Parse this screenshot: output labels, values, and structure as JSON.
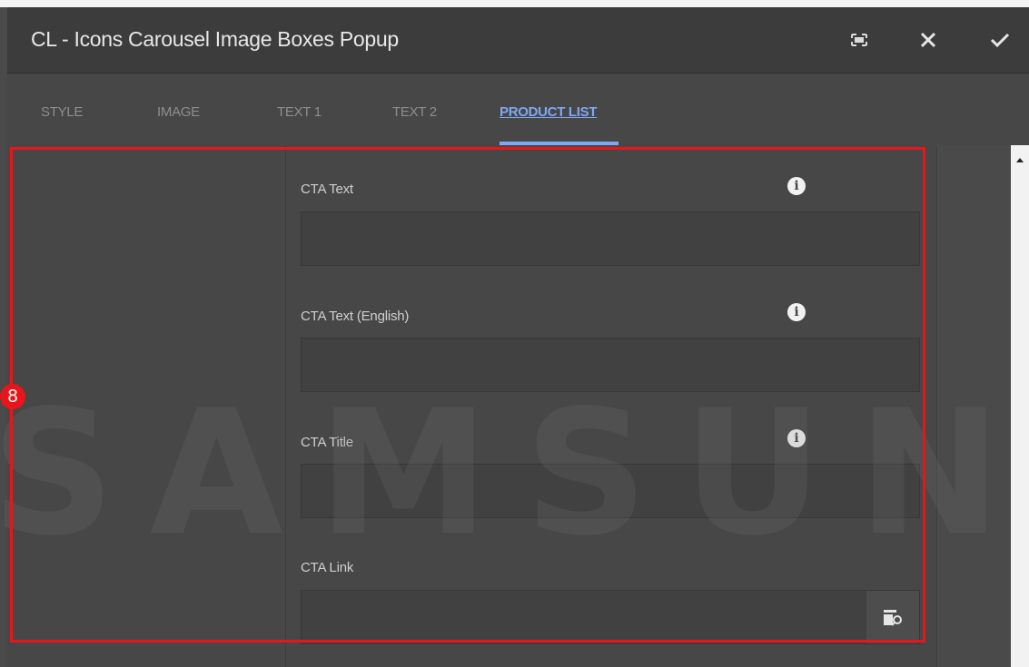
{
  "dialog": {
    "title": "CL - Icons Carousel Image Boxes Popup",
    "actions": [
      "fullscreen-icon",
      "close-icon",
      "checkmark-icon"
    ]
  },
  "tabs": [
    {
      "label": "STYLE",
      "active": false
    },
    {
      "label": "IMAGE",
      "active": false
    },
    {
      "label": "TEXT 1",
      "active": false
    },
    {
      "label": "TEXT 2",
      "active": false
    },
    {
      "label": "PRODUCT LIST",
      "active": true
    }
  ],
  "form": {
    "fields": [
      {
        "label": "CTA Text",
        "value": "",
        "has_info": true
      },
      {
        "label": "CTA Text (English)",
        "value": "",
        "has_info": true
      },
      {
        "label": "CTA Title",
        "value": "",
        "has_info": true
      },
      {
        "label": "CTA Link",
        "value": "",
        "has_info": false,
        "browse_icon": "path-browser-icon"
      }
    ]
  },
  "annotation": {
    "badge": "8",
    "color": "#e8161b"
  },
  "watermark": "SAMSUNG",
  "colors": {
    "accent": "#7fa7f4",
    "highlight": "#e8161b"
  }
}
